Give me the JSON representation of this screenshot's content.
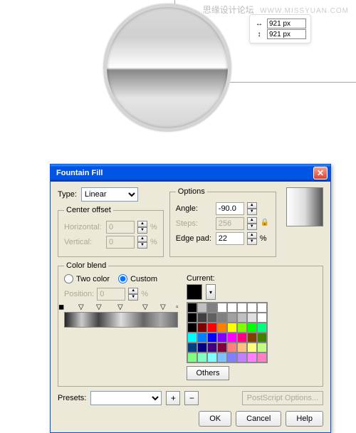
{
  "watermark": {
    "zh": "思缘设计论坛",
    "en": "WWW.MISSYUAN.COM"
  },
  "dimensions": {
    "w": "921 px",
    "h": "921 px"
  },
  "dialog": {
    "title": "Fountain Fill",
    "type_label": "Type:",
    "type_value": "Linear",
    "center_offset": {
      "legend": "Center offset",
      "horizontal_label": "Horizontal:",
      "horizontal_value": "0",
      "vertical_label": "Vertical:",
      "vertical_value": "0",
      "pct": "%"
    },
    "options": {
      "legend": "Options",
      "angle_label": "Angle:",
      "angle_value": "-90.0",
      "steps_label": "Steps:",
      "steps_value": "256",
      "edgepad_label": "Edge pad:",
      "edgepad_value": "22",
      "pct": "%"
    },
    "color_blend": {
      "legend": "Color blend",
      "two_color_label": "Two color",
      "custom_label": "Custom",
      "position_label": "Position:",
      "position_value": "0",
      "pct": "%",
      "current_label": "Current:",
      "others_label": "Others"
    },
    "presets": {
      "label": "Presets:",
      "value": "",
      "ps_label": "PostScript Options..."
    },
    "buttons": {
      "ok": "OK",
      "cancel": "Cancel",
      "help": "Help"
    }
  },
  "palette": [
    "#000000",
    "#c0c0c0",
    "#808080",
    "#ffffff",
    "#ffffff",
    "#ffffff",
    "#ffffff",
    "#ffffff",
    "#000000",
    "#404040",
    "#606060",
    "#808080",
    "#a0a0a0",
    "#c0c0c0",
    "#e0e0e0",
    "#ffffff",
    "#000000",
    "#800000",
    "#ff0000",
    "#ff8000",
    "#ffff00",
    "#80ff00",
    "#00ff00",
    "#00ff80",
    "#00ffff",
    "#0080ff",
    "#0000ff",
    "#8000ff",
    "#ff00ff",
    "#ff0080",
    "#804000",
    "#408000",
    "#004080",
    "#000080",
    "#400080",
    "#800040",
    "#ff8080",
    "#ffc080",
    "#ffff80",
    "#c0ff80",
    "#80ff80",
    "#80ffc0",
    "#80ffff",
    "#80c0ff",
    "#8080ff",
    "#c080ff",
    "#ff80ff",
    "#ff80c0"
  ]
}
